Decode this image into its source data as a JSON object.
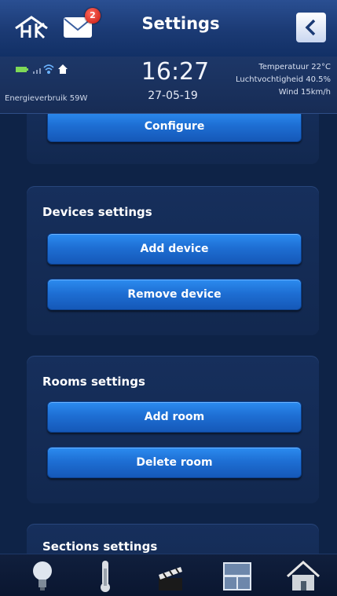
{
  "header": {
    "title": "Settings",
    "mail_badge": "2",
    "icons": [
      "home-logo-icon",
      "mail-icon",
      "back-arrow-icon"
    ]
  },
  "status": {
    "time": "16:27",
    "date": "27-05-19",
    "energy": "Energieverbruik 59W",
    "temperature": "Temperatuur 22°C",
    "humidity": "Luchtvochtigheid 40.5%",
    "wind": "Wind 15km/h",
    "icons": [
      "battery-icon",
      "signal-icon",
      "wifi-icon",
      "home-status-icon"
    ]
  },
  "cards": {
    "top": {
      "configure": "Configure"
    },
    "devices": {
      "title": "Devices settings",
      "add": "Add device",
      "remove": "Remove device"
    },
    "rooms": {
      "title": "Rooms settings",
      "add": "Add room",
      "delete": "Delete room"
    },
    "sections": {
      "title": "Sections settings"
    }
  },
  "nav": {
    "icons": [
      "light-bulb-icon",
      "thermometer-icon",
      "scenes-clapper-icon",
      "window-shutter-icon",
      "house-icon"
    ]
  },
  "colors": {
    "background": "#0e2347",
    "button": "#1e6fd4",
    "badge": "#d11a10"
  }
}
